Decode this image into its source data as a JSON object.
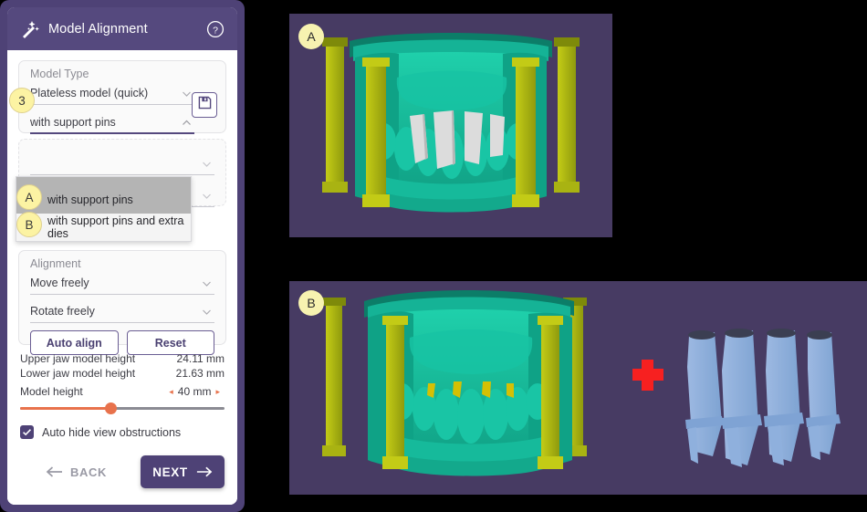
{
  "header": {
    "title": "Model Alignment",
    "wand_icon": "magic-wand-icon",
    "help_icon": "help-circle-icon"
  },
  "model_type_card": {
    "label": "Model Type",
    "primary_value": "Plateless model (quick)",
    "secondary_value": "with support pins",
    "save_icon": "floppy-disk-save-icon",
    "step_badge": "3"
  },
  "dropdown": {
    "options": [
      {
        "badge": "A",
        "label": "with support pins",
        "highlighted": true
      },
      {
        "badge": "B",
        "label": "with support pins and extra dies",
        "highlighted": false
      }
    ]
  },
  "alignment_card": {
    "label": "Alignment",
    "move_value": "Move freely",
    "rotate_value": "Rotate freely",
    "auto_align_label": "Auto align",
    "reset_label": "Reset"
  },
  "measurements": [
    {
      "key": "Upper jaw model height",
      "value": "24.11 mm"
    },
    {
      "key": "Lower jaw model height",
      "value": "21.63 mm"
    }
  ],
  "model_height": {
    "label": "Model height",
    "value": "40 mm",
    "dec_arrow": "◂",
    "inc_arrow": "▸",
    "percent": 44
  },
  "checkbox": {
    "label": "Auto hide view obstructions",
    "checked": true
  },
  "footer": {
    "back_label": "BACK",
    "next_label": "NEXT"
  },
  "viewports": [
    {
      "id": "A",
      "label": "A"
    },
    {
      "id": "B",
      "label": "B"
    }
  ],
  "colors": {
    "purple": "#55497e",
    "panel_border": "#4e4276",
    "orange": "#e8724c",
    "viewport_bg": "#473b63",
    "teal": "#14b89a",
    "olive": "#b3bb14",
    "die_blue": "#8fb0dd",
    "plus_red": "#f72020",
    "badge_yellow": "#fcf3a3"
  }
}
